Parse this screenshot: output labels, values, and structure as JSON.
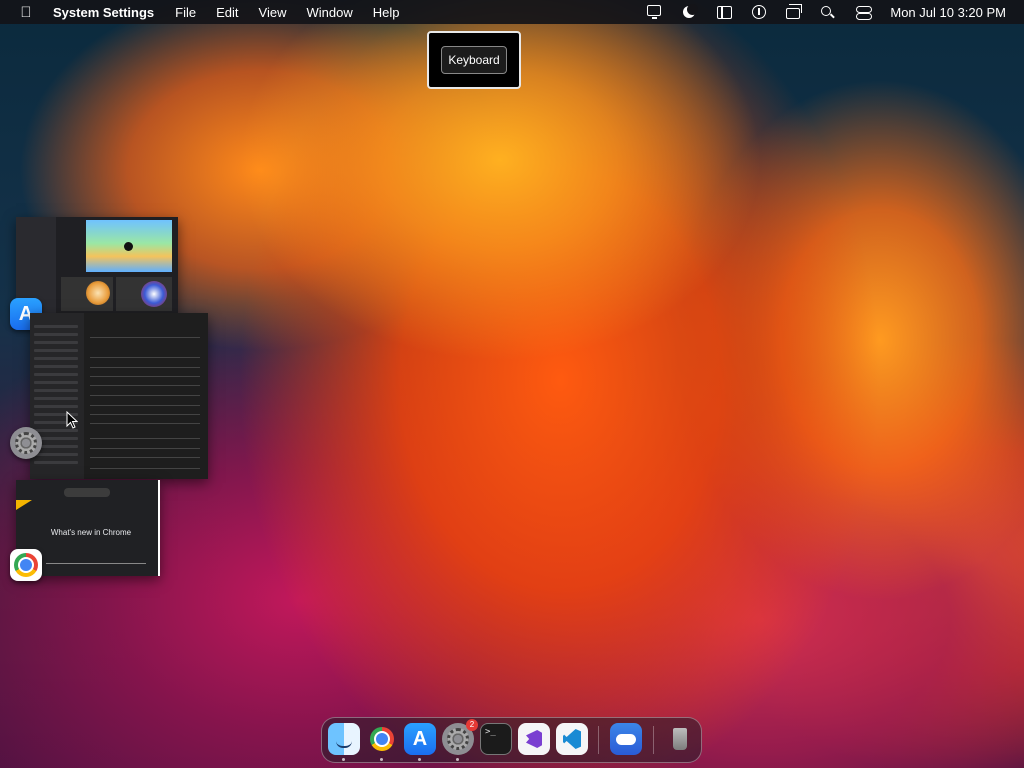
{
  "menubar": {
    "app_name": "System Settings",
    "menus": [
      "File",
      "Edit",
      "View",
      "Window",
      "Help"
    ],
    "status_icons": [
      "display-icon",
      "focus-moon-icon",
      "stage-manager-icon",
      "accessibility-icon",
      "window-tiling-icon",
      "spotlight-search-icon",
      "control-center-icon"
    ],
    "clock": "Mon Jul 10  3:20 PM"
  },
  "hud": {
    "label": "Keyboard"
  },
  "stage_manager": {
    "thumbnails": [
      {
        "app": "App Store",
        "icon": "app-store-icon"
      },
      {
        "app": "System Settings",
        "icon": "system-settings-icon"
      },
      {
        "app": "Google Chrome",
        "icon": "chrome-icon",
        "preview_text": "What's new in Chrome"
      }
    ]
  },
  "dock": {
    "items": [
      {
        "name": "Finder",
        "icon": "finder-icon",
        "running": true
      },
      {
        "name": "Google Chrome",
        "icon": "chrome-icon",
        "running": true
      },
      {
        "name": "App Store",
        "icon": "app-store-icon",
        "running": true
      },
      {
        "name": "System Settings",
        "icon": "system-settings-icon",
        "running": true,
        "badge": "2"
      },
      {
        "name": "Terminal",
        "icon": "terminal-icon",
        "running": false
      },
      {
        "name": "Visual Studio",
        "icon": "visual-studio-icon",
        "running": false
      },
      {
        "name": "Visual Studio Code",
        "icon": "vscode-icon",
        "running": false
      },
      {
        "name": "Weather",
        "icon": "weather-icon",
        "running": false
      },
      {
        "name": "Trash",
        "icon": "trash-icon",
        "running": false
      }
    ],
    "terminal_glyph": ">_"
  },
  "colors": {
    "menubar_bg": "#141418",
    "accent_orange": "#ff5a10",
    "badge_red": "#e53935"
  }
}
